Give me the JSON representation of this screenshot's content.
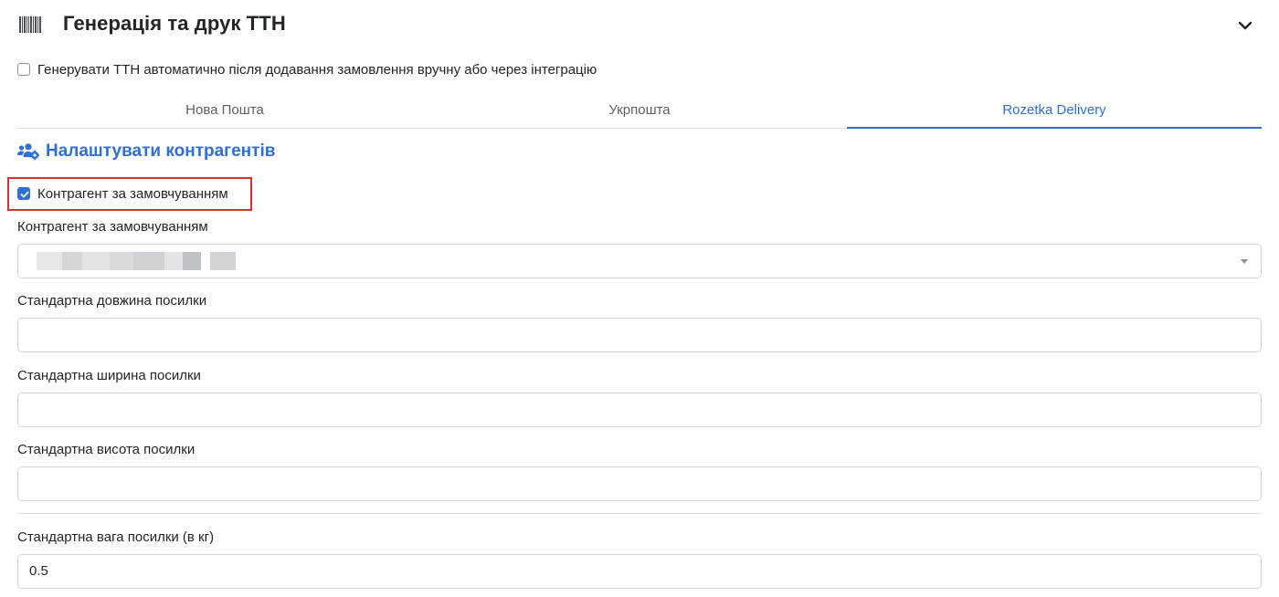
{
  "header": {
    "icon": "barcode-icon",
    "title": "Генерація та друк ТТН",
    "collapse_icon": "chevron-down-icon"
  },
  "auto_generate": {
    "checked": false,
    "label": "Генерувати ТТН автоматично після додавання замовлення вручну або через інтеграцію"
  },
  "tabs": [
    {
      "label": "Нова Пошта",
      "active": false
    },
    {
      "label": "Укрпошта",
      "active": false
    },
    {
      "label": "Rozetka Delivery",
      "active": true
    }
  ],
  "section": {
    "icon": "users-cog-icon",
    "title": "Налаштувати контрагентів"
  },
  "default_counterparty_checkbox": {
    "checked": true,
    "label": "Контрагент за замовчуванням"
  },
  "fields": {
    "counterparty": {
      "label": "Контрагент за замовчуванням",
      "value": ""
    },
    "length": {
      "label": "Стандартна довжина посилки",
      "value": ""
    },
    "width": {
      "label": "Стандартна ширина посилки",
      "value": ""
    },
    "height": {
      "label": "Стандартна висота посилки",
      "value": ""
    },
    "weight": {
      "label": "Стандартна вага посилки (в кг)",
      "value": "0.5"
    }
  },
  "colors": {
    "accent": "#2f6fd6",
    "highlight": "#dc2f2f",
    "border": "#ced4da"
  }
}
